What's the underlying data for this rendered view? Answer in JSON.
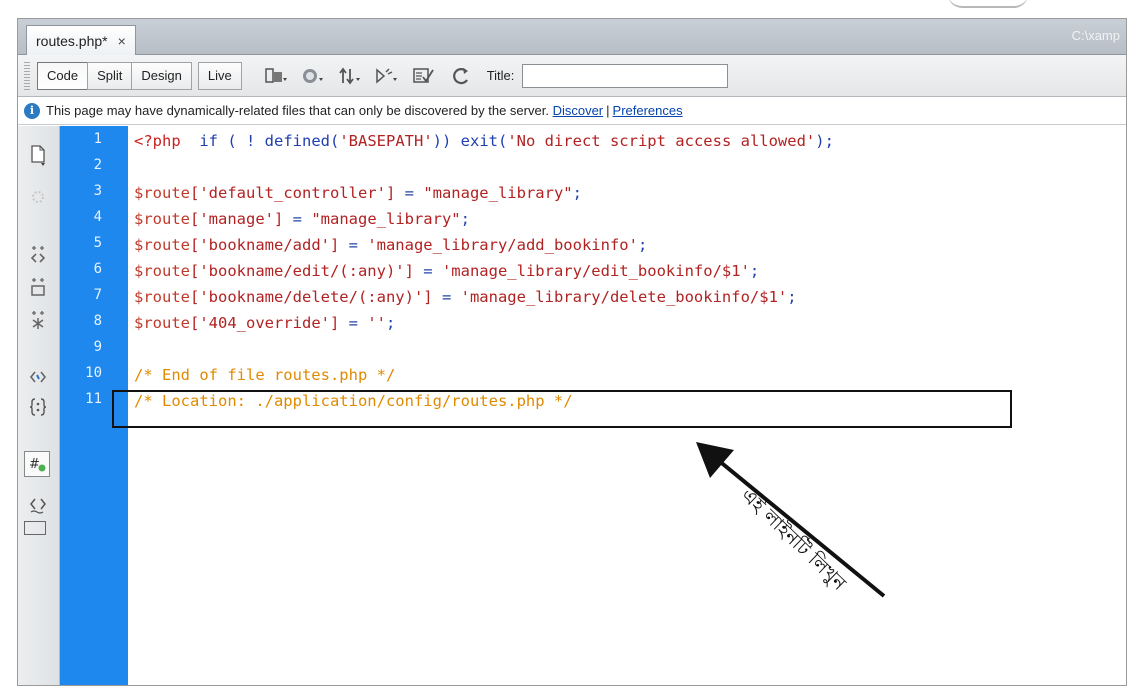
{
  "tab": {
    "filename": "routes.php*",
    "close": "×"
  },
  "path": "C:\\xamp",
  "toolbar": {
    "views": [
      "Code",
      "Split",
      "Design",
      "Live"
    ],
    "icons": [
      "multiscreen-icon",
      "browser-preview-icon",
      "file-management-icon",
      "validate-icon",
      "check-page-icon",
      "refresh-icon"
    ],
    "title_label": "Title:",
    "title_value": ""
  },
  "infobar": {
    "message": "This page may have dynamically-related files that can only be discovered by the server.",
    "discover": "Discover",
    "separator": "|",
    "preferences": "Preferences"
  },
  "sidebar_icons": [
    "open-documents-icon",
    "collapse-full-tag-icon",
    "collapse-selection-icon",
    "expand-all-icon",
    "select-parent-tag-icon",
    "balance-braces-icon",
    "apply-comment-icon",
    "format-source-icon",
    "wrap-tag-icon",
    "indent-icon"
  ],
  "line_numbers": [
    "1",
    "2",
    "3",
    "4",
    "5",
    "6",
    "7",
    "8",
    "9",
    "10",
    "11"
  ],
  "code": {
    "l1": {
      "tag": "<?php",
      "kw": "if ( ! defined(",
      "str": "'BASEPATH'",
      "rest": ")) exit(",
      "str2": "'No direct script access allowed'",
      "end": ");"
    },
    "l3": {
      "var": "$route",
      "key": "['default_controller']",
      "eq": " = ",
      "val": "\"manage_library\"",
      "semi": ";"
    },
    "l4": {
      "var": "$route",
      "key": "['manage']",
      "eq": " = ",
      "val": "\"manage_library\"",
      "semi": ";"
    },
    "l5": {
      "var": "$route",
      "key": "['bookname/add']",
      "eq": " = ",
      "val": "'manage_library/add_bookinfo'",
      "semi": ";"
    },
    "l6": {
      "var": "$route",
      "key": "['bookname/edit/(:any)']",
      "eq": " = ",
      "val": "'manage_library/edit_bookinfo/$1'",
      "semi": ";"
    },
    "l7": {
      "var": "$route",
      "key": "['bookname/delete/(:any)']",
      "eq": " = ",
      "val": "'manage_library/delete_bookinfo/$1'",
      "semi": ";"
    },
    "l8": {
      "var": "$route",
      "key": "['404_override']",
      "eq": " = ",
      "val": "''",
      "semi": ";"
    },
    "l10": "/* End of file routes.php */",
    "l11": "/* Location: ./application/config/routes.php */"
  },
  "annotation": "এই লাইনটি লিখুন",
  "colors": {
    "gutter": "#1e88ee",
    "comment": "#e08a00",
    "string": "#b22222"
  }
}
